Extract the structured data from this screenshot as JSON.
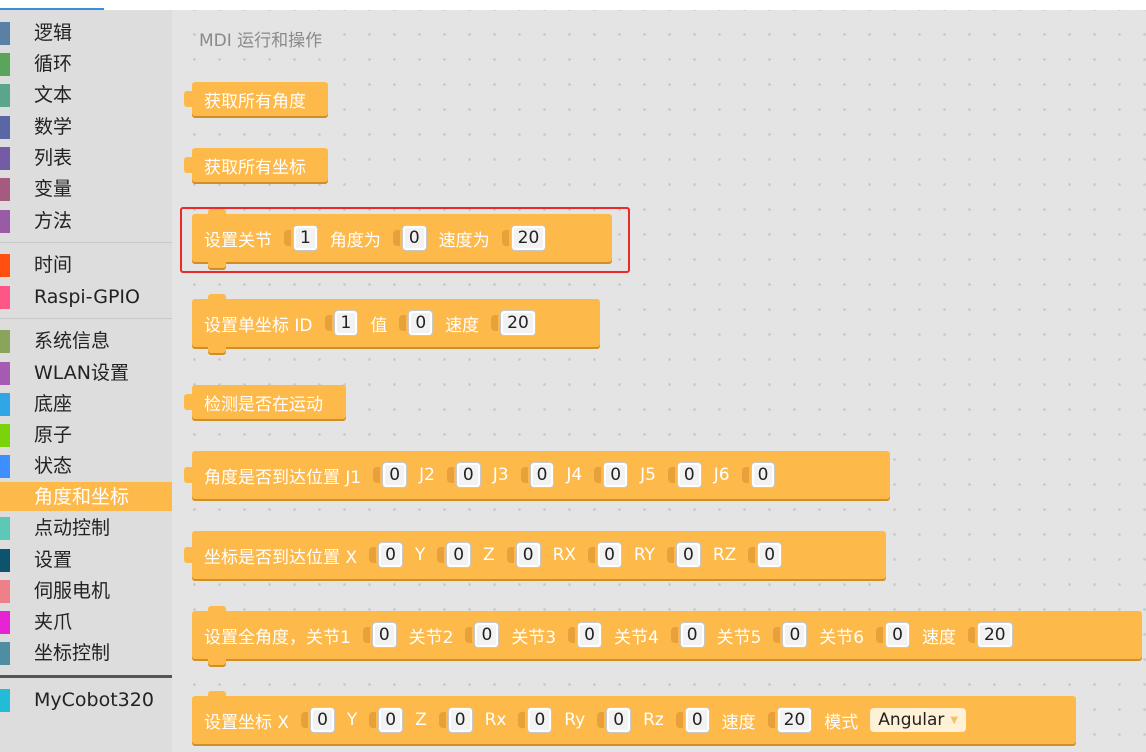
{
  "sidebar": {
    "categories": [
      {
        "label": "逻辑",
        "color": "#5b80a5"
      },
      {
        "label": "循环",
        "color": "#5ba55b"
      },
      {
        "label": "文本",
        "color": "#5ba58c"
      },
      {
        "label": "数学",
        "color": "#5b67a5"
      },
      {
        "label": "列表",
        "color": "#745ba5"
      },
      {
        "label": "变量",
        "color": "#a55b80"
      },
      {
        "label": "方法",
        "color": "#995ba5"
      },
      {
        "label": "时间",
        "color": "#ff4f11"
      },
      {
        "label": "Raspi-GPIO",
        "color": "#ff5688"
      },
      {
        "label": "系统信息",
        "color": "#8aa55b"
      },
      {
        "label": "WLAN设置",
        "color": "#a55bb1"
      },
      {
        "label": "底座",
        "color": "#2fa6e6"
      },
      {
        "label": "原子",
        "color": "#7bd30b"
      },
      {
        "label": "状态",
        "color": "#3d8eff"
      },
      {
        "label": "角度和坐标",
        "color": "#fdb94a",
        "selected": true
      },
      {
        "label": "点动控制",
        "color": "#5cc8b7"
      },
      {
        "label": "设置",
        "color": "#0e536d"
      },
      {
        "label": "伺服电机",
        "color": "#f08088"
      },
      {
        "label": "夹爪",
        "color": "#e624d6"
      },
      {
        "label": "坐标控制",
        "color": "#4f8ea0"
      },
      {
        "label": "MyCobot320",
        "color": "#22bcd6"
      }
    ]
  },
  "workspace": {
    "title": "MDI 运行和操作",
    "blocks": {
      "get_angles": {
        "label": "获取所有角度"
      },
      "get_coords": {
        "label": "获取所有坐标"
      },
      "send_angle": {
        "label": "设置关节",
        "joint": "1",
        "angle_label": "角度为",
        "angle": "0",
        "speed_label": "速度为",
        "speed": "20"
      },
      "send_coord": {
        "label": "设置单坐标 ID",
        "id": "1",
        "value_label": "值",
        "value": "0",
        "speed_label": "速度",
        "speed": "20"
      },
      "is_moving": {
        "label": "检测是否在运动"
      },
      "is_in_position_angles": {
        "label": "角度是否到达位置 J1",
        "j1": "0",
        "j2_label": "J2",
        "j2": "0",
        "j3_label": "J3",
        "j3": "0",
        "j4_label": "J4",
        "j4": "0",
        "j5_label": "J5",
        "j5": "0",
        "j6_label": "J6",
        "j6": "0"
      },
      "is_in_position_coords": {
        "label": "坐标是否到达位置 X",
        "x": "0",
        "y_label": "Y",
        "y": "0",
        "z_label": "Z",
        "z": "0",
        "rx_label": "RX",
        "rx": "0",
        "ry_label": "RY",
        "ry": "0",
        "rz_label": "RZ",
        "rz": "0"
      },
      "send_angles": {
        "label": "设置全角度，关节1",
        "j1": "0",
        "j2_label": "关节2",
        "j2": "0",
        "j3_label": "关节3",
        "j3": "0",
        "j4_label": "关节4",
        "j4": "0",
        "j5_label": "关节5",
        "j5": "0",
        "j6_label": "关节6",
        "j6": "0",
        "speed_label": "速度",
        "speed": "20"
      },
      "send_coords": {
        "label": "设置坐标 X",
        "x": "0",
        "y_label": "Y",
        "y": "0",
        "z_label": "Z",
        "z": "0",
        "rx_label": "Rx",
        "rx": "0",
        "ry_label": "Ry",
        "ry": "0",
        "rz_label": "Rz",
        "rz": "0",
        "speed_label": "速度",
        "speed": "20",
        "mode_label": "模式",
        "mode": "Angular"
      }
    }
  },
  "colors": {
    "block": "#fdb94a",
    "highlight": "#e82a2a",
    "accent": "#3b8fd6"
  }
}
